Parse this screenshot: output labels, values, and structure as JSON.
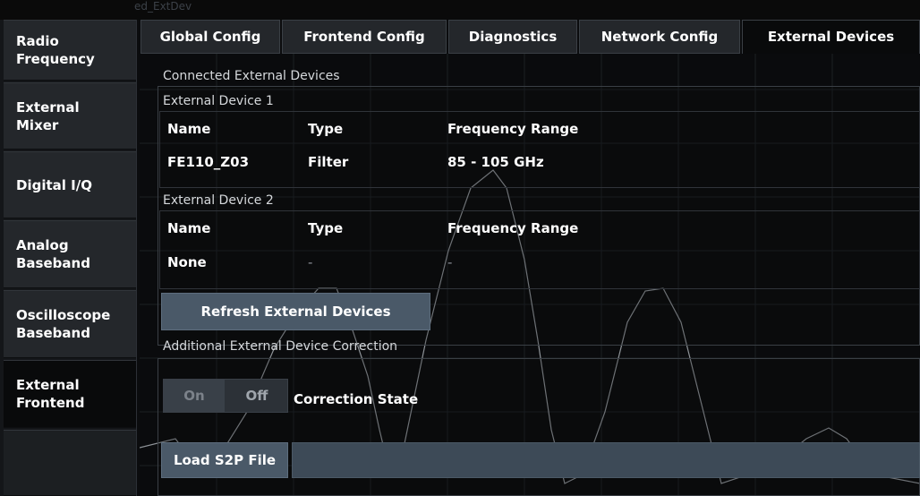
{
  "window": {
    "ghost_title": "ed_ExtDev",
    "bottom_left_ghost": "..."
  },
  "left_nav": {
    "items": [
      {
        "label": "Radio\nFrequency",
        "active": false
      },
      {
        "label": "External\nMixer",
        "active": false
      },
      {
        "label": "Digital I/Q",
        "active": false
      },
      {
        "label": "Analog\nBaseband",
        "active": false
      },
      {
        "label": "Oscilloscope\nBaseband",
        "active": false
      },
      {
        "label": "External\nFrontend",
        "active": true
      },
      {
        "label": "",
        "active": false
      }
    ]
  },
  "tabs": [
    {
      "label": "Global Config",
      "active": false
    },
    {
      "label": "Frontend Config",
      "active": false
    },
    {
      "label": "Diagnostics",
      "active": false
    },
    {
      "label": "Network Config",
      "active": false
    },
    {
      "label": "External Devices",
      "active": true
    }
  ],
  "connected": {
    "section_label": "Connected External Devices",
    "devices": [
      {
        "title": "External Device 1",
        "headers": {
          "name": "Name",
          "type": "Type",
          "freq": "Frequency Range"
        },
        "values": {
          "name": "FE110_Z03",
          "type": "Filter",
          "freq": "85 - 105 GHz"
        }
      },
      {
        "title": "External Device 2",
        "headers": {
          "name": "Name",
          "type": "Type",
          "freq": "Frequency Range"
        },
        "values": {
          "name": "None",
          "type": "-",
          "freq": "-"
        }
      }
    ],
    "refresh_button": "Refresh External Devices"
  },
  "correction": {
    "section_label": "Additional External Device Correction",
    "toggle": {
      "on_label": "On",
      "off_label": "Off",
      "state": "Off"
    },
    "state_label": "Correction State",
    "load_button": "Load S2P File",
    "file_value": ""
  },
  "colors": {
    "accent_button": "#4a5968",
    "panel": "#24272b",
    "active": "#090a0b",
    "trace": "#8e9398"
  }
}
